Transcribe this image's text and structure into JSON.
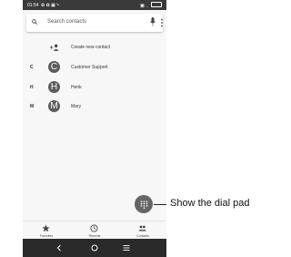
{
  "status_bar": {
    "time": "01:54",
    "icons": "✿ ✿ ▣ ⁱˢ",
    "right": "▣ .."
  },
  "search": {
    "placeholder": "Search contacts"
  },
  "create_contact": {
    "label": "Create new contact"
  },
  "contacts": [
    {
      "section": "C",
      "initial": "C",
      "name": "Customer Support"
    },
    {
      "section": "H",
      "initial": "H",
      "name": "Henk"
    },
    {
      "section": "M",
      "initial": "M",
      "name": "Mary"
    }
  ],
  "callout": {
    "label": "Show the dial pad"
  },
  "bottom_nav": [
    {
      "label": "Favorites",
      "icon": "star-icon"
    },
    {
      "label": "Recents",
      "icon": "clock-icon"
    },
    {
      "label": "Contacts",
      "icon": "people-icon"
    }
  ],
  "system_nav": {
    "back": "back-icon",
    "home": "home-icon",
    "recents": "menu-icon"
  },
  "colors": {
    "avatar": "#5c5c5c",
    "fab": "#666666",
    "status_bar": "#3a3a3a",
    "nav_bar": "#2a2a2a"
  }
}
